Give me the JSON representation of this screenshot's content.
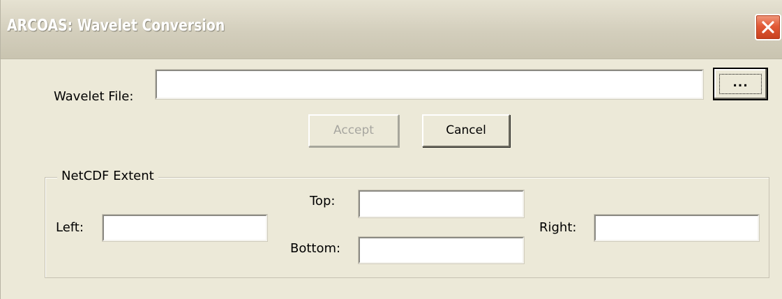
{
  "window": {
    "title": "ARCOAS:  Wavelet Conversion"
  },
  "file_row": {
    "label": "Wavelet File:",
    "value": "",
    "browse_label": "..."
  },
  "buttons": {
    "accept_label": "Accept",
    "cancel_label": "Cancel"
  },
  "extent": {
    "group_label": "NetCDF Extent",
    "left_label": "Left:",
    "left_value": "",
    "top_label": "Top:",
    "top_value": "",
    "bottom_label": "Bottom:",
    "bottom_value": "",
    "right_label": "Right:",
    "right_value": ""
  },
  "colors": {
    "dialog_background": "#ece9d8",
    "close_button": "#e25a37",
    "disabled_text": "#a7a6a0"
  },
  "icons": {
    "close": "close-icon"
  }
}
